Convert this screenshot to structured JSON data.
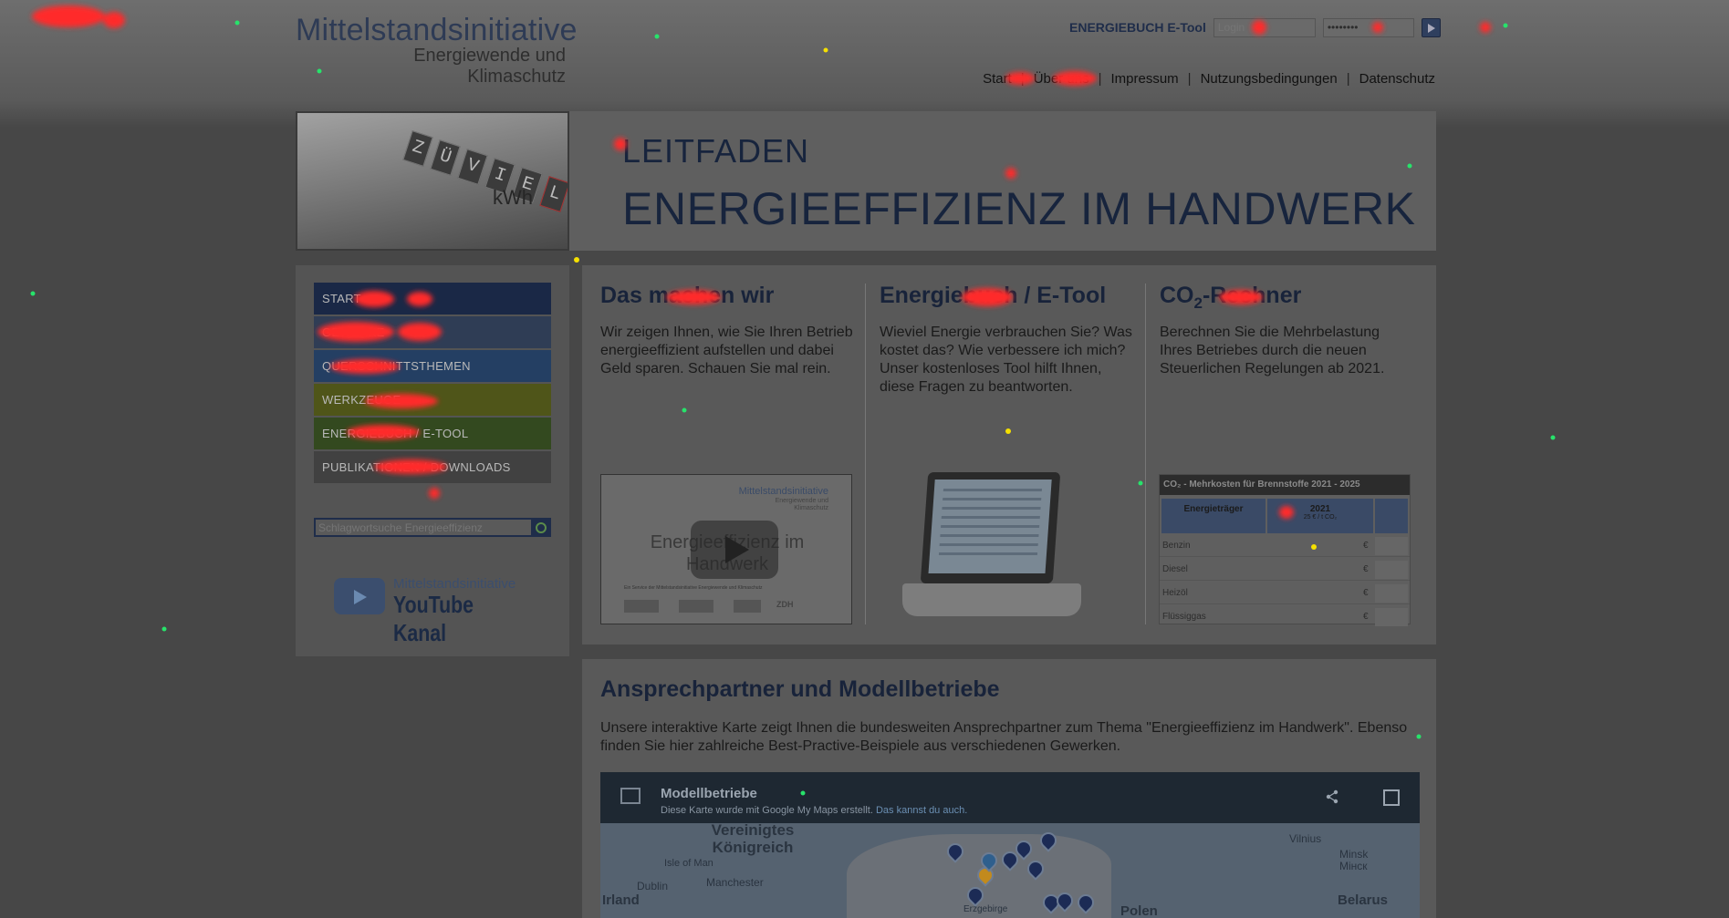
{
  "header": {
    "brand_title": "Mittelstandsinitiative",
    "brand_subtitle": "Energiewende und Klimaschutz",
    "login": {
      "label": "ENERGIEBUCH E-Tool",
      "user_placeholder": "Login",
      "password_value": "••••••••"
    },
    "nav": [
      "Start",
      "Über uns",
      "Impressum",
      "Nutzungsbedingungen",
      "Datenschutz"
    ],
    "nav_separator": "|"
  },
  "banner": {
    "meter_digits": [
      "Z",
      "Ü",
      "V",
      "I",
      "E",
      "L"
    ],
    "meter_unit": "kWh",
    "kicker": "LEITFADEN",
    "headline": "ENERGIEEFFIZIENZ IM HANDWERK"
  },
  "sidebar": {
    "items": [
      {
        "label": "START",
        "color": "#1a2846"
      },
      {
        "label": "GEWERKE",
        "color": "#2f3d55"
      },
      {
        "label": "QUERSCHNITTSTHEMEN",
        "color": "#243f63"
      },
      {
        "label": "WERKZEUGE",
        "color": "#4f5519"
      },
      {
        "label": "ENERGIEBUCH / E-TOOL",
        "color": "#33491f"
      },
      {
        "label": "PUBLIKATIONEN / DOWNLOADS",
        "color": "#414141"
      }
    ],
    "search_placeholder": "Schlagwortsuche Energieeffizienz",
    "youtube_small": "Mittelstandsinitiative",
    "youtube_big": "YouTube Kanal"
  },
  "features": [
    {
      "title": "Das machen wir",
      "text": "Wir zeigen Ihnen, wie Sie Ihren Betrieb energieeffizient aufstellen und dabei Geld sparen. Schauen Sie mal rein."
    },
    {
      "title": "Energiebuch / E-Tool",
      "text": "Wieviel Energie verbrauchen Sie? Was kostet das? Wie verbessere ich mich? Unser kostenloses Tool hilft Ihnen, diese Fragen zu beantworten."
    },
    {
      "title_main": "CO",
      "title_sub": "2",
      "title_rest": "-Rechner",
      "text": "Berechnen Sie die Mehrbelastung Ihres Betriebes durch die neuen Steuerlichen Regelungen ab 2021."
    }
  ],
  "video_thumb": {
    "brand": "Mittelstandsinitiative",
    "brand_sub": "Energiewende und Klimaschutz",
    "title": "Energieeffizienz im Handwerk",
    "caption": "Ein Service der Mittelstandsinitiative Energiewende und Klimaschutz",
    "logo_text": "ZDH"
  },
  "co2_table": {
    "heading": "CO₂ - Mehrkosten für Brennstoffe  2021 - 2025",
    "col_carrier": "Energieträger",
    "col_year": "2021",
    "col_year_sub": "25 € / t CO₂",
    "rows": [
      "Benzin",
      "Diesel",
      "Heizöl",
      "Flüssiggas"
    ],
    "currency": "€"
  },
  "contact": {
    "title": "Ansprechpartner und Modellbetriebe",
    "text": "Unsere interaktive Karte zeigt Ihnen die bundesweiten Ansprechpartner zum Thema \"Energieeffizienz im Handwerk\". Ebenso finden Sie hier zahlreiche Best-Practive-Beispiele aus verschiedenen Gewerken."
  },
  "map": {
    "title": "Modellbetriebe",
    "note": "Diese Karte wurde mit Google My Maps erstellt.",
    "note_link": "Das kannst du auch.",
    "labels": {
      "uk": "Vereinigtes Königreich",
      "isle_of_man": "Isle of Man",
      "dublin": "Dublin",
      "manchester": "Manchester",
      "ireland": "Irland",
      "vilnius": "Vilnius",
      "minsk": "Minsk Мінск",
      "poland": "Polen",
      "belarus": "Belarus",
      "pin_label": "Erzgebirge"
    }
  },
  "colors": {
    "navy": "#17243d",
    "heat_hot": "#ff2a2a",
    "heat_warm": "#f5e000",
    "heat_cool": "#27e36b"
  }
}
